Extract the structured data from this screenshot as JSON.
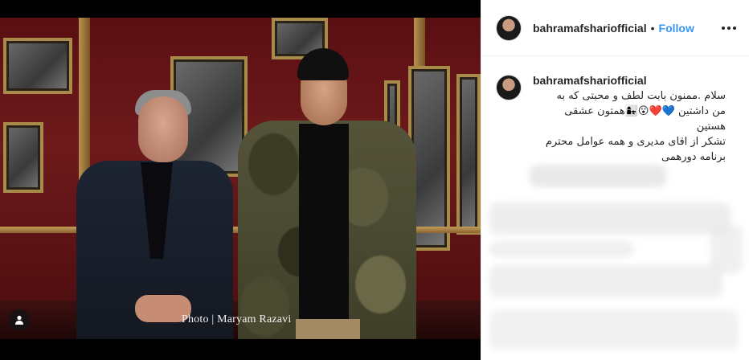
{
  "photo": {
    "credit": "Photo | Maryam Razavi",
    "tag_icon": "user-tag-icon"
  },
  "post": {
    "username": "bahramafshariofficial",
    "separator": "•",
    "follow_label": "Follow",
    "more_icon": "more-options-icon",
    "caption": {
      "username": "bahramafshariofficial",
      "lines": [
        "سلام .ممنون بابت لطف و محبتی که به",
        "من داشتین 💙❤️😮👩‍👧همتون عشقی",
        "هستین",
        "تشکر از اقای مدیری و همه عوامل محترم",
        "برنامه دورهمی"
      ]
    }
  },
  "colors": {
    "link_blue": "#3897f0",
    "text": "#262626",
    "border": "#efefef"
  }
}
